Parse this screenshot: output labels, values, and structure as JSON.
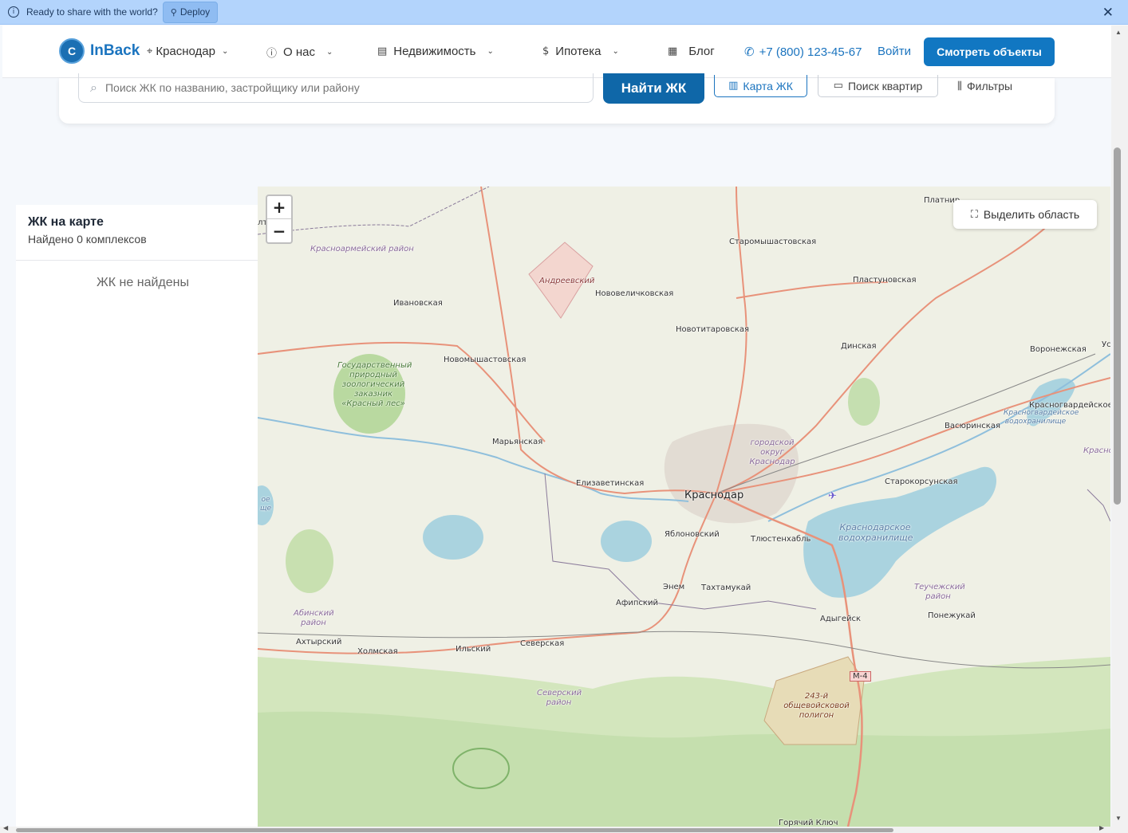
{
  "banner": {
    "message": "Ready to share with the world?",
    "deploy_label": "Deploy"
  },
  "header": {
    "logo_letter": "C",
    "logo_text": "InBack",
    "city": "Краснодар",
    "nav": [
      {
        "label": "О нас"
      },
      {
        "label": "Недвижимость"
      },
      {
        "label": "Ипотека"
      },
      {
        "label": "Блог"
      }
    ],
    "phone": "+7 (800) 123-45-67",
    "login": "Войти",
    "cta": "Смотреть объекты"
  },
  "search": {
    "placeholder": "Поиск ЖК по названию, застройщику или району",
    "find_label": "Найти ЖК",
    "map_label": "Карта ЖК",
    "flats_label": "Поиск квартир",
    "filters_label": "Фильтры"
  },
  "sidebar": {
    "title": "ЖК на карте",
    "count": "Найдено 0 комплексов",
    "empty": "ЖК не найдены"
  },
  "map": {
    "zoom_in": "+",
    "zoom_out": "−",
    "select_area": "Выделить область",
    "labels": {
      "krasnodar": "Краснодар",
      "staromyshastovskaya": "Старомышастовская",
      "platnirovskaya": "Платнир",
      "plastunovskaya": "Пластуновская",
      "novovelichkovskaya": "Нововеличковская",
      "novotitarovskaya": "Новотитаровская",
      "dinskaya": "Динская",
      "voronezhskaya": "Воронежская",
      "ivanovskaya": "Ивановская",
      "novomyshastovskaya": "Новомышастовская",
      "krasnogvardeyskoe": "Красногвардейское",
      "vasyurinskaya": "Васюринская",
      "maryanskaya": "Марьянская",
      "elizavetinskaya": "Елизаветинская",
      "starokorsunskaya": "Старокорсунская",
      "yablonovsky": "Яблоновский",
      "tlyustenkhabl": "Тлюстенхабль",
      "enem": "Энем",
      "takhtamukay": "Тахтамукай",
      "afipsky": "Афипский",
      "adygeysk": "Адыгейск",
      "ponezhukay": "Понежукай",
      "akhtyrsky": "Ахтырский",
      "kholmskaya": "Холмская",
      "ilsky": "Ильский",
      "severskaya": "Северская",
      "goryachy_klyuch": "Горячий Ключ",
      "ust": "Ус",
      "krasno": "Красно",
      "lta": "лта"
    },
    "areas": {
      "krasnoarmeysky": "Красноармейский район",
      "andreevsky": "Андреевский",
      "zakaznik": "Государственный природный зоологический заказник «Красный лес»",
      "gorodskoy_okrug": "городской округ Краснодар",
      "krasnodar_reservoir": "Краснодарское водохранилище",
      "krasnogvard_reservoir": "Красногвардейское водохранилище",
      "teuchezhsky": "Теучежский район",
      "abinsky": "Абинский район",
      "seversky": "Северский район",
      "polygon": "243-й общевойсковой полигон",
      "reservoir_edge": "ое ще"
    },
    "road_shield": "М-4"
  }
}
